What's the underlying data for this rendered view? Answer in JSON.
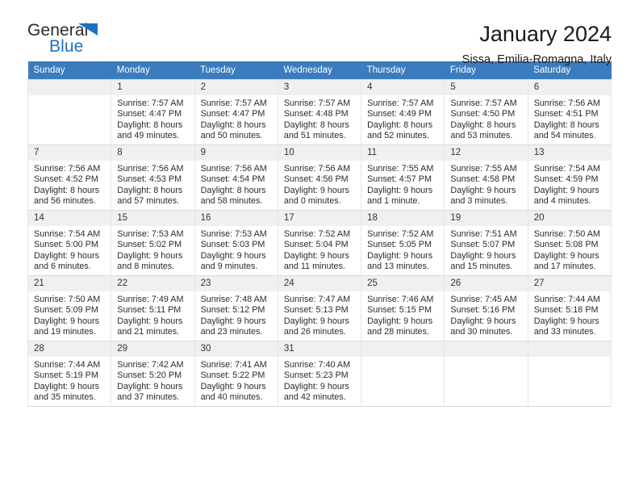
{
  "brand": {
    "name_part1": "General",
    "name_part2": "Blue",
    "triangle_icon": "triangle-icon",
    "accent_color": "#1a72c4"
  },
  "header": {
    "title": "January 2024",
    "subtitle": "Sissa, Emilia-Romagna, Italy"
  },
  "colors": {
    "header_row_bg": "#3a7cbe",
    "daynum_bg": "#f0f0f0",
    "grid_line": "#d9d9d9"
  },
  "calendar": {
    "weekday_headers": [
      "Sunday",
      "Monday",
      "Tuesday",
      "Wednesday",
      "Thursday",
      "Friday",
      "Saturday"
    ],
    "labels": {
      "sunrise": "Sunrise:",
      "sunset": "Sunset:",
      "daylight": "Daylight:"
    },
    "weeks": [
      [
        {
          "day": "",
          "empty": true
        },
        {
          "day": "1",
          "sunrise": "Sunrise: 7:57 AM",
          "sunset": "Sunset: 4:47 PM",
          "daylight": "Daylight: 8 hours and 49 minutes."
        },
        {
          "day": "2",
          "sunrise": "Sunrise: 7:57 AM",
          "sunset": "Sunset: 4:47 PM",
          "daylight": "Daylight: 8 hours and 50 minutes."
        },
        {
          "day": "3",
          "sunrise": "Sunrise: 7:57 AM",
          "sunset": "Sunset: 4:48 PM",
          "daylight": "Daylight: 8 hours and 51 minutes."
        },
        {
          "day": "4",
          "sunrise": "Sunrise: 7:57 AM",
          "sunset": "Sunset: 4:49 PM",
          "daylight": "Daylight: 8 hours and 52 minutes."
        },
        {
          "day": "5",
          "sunrise": "Sunrise: 7:57 AM",
          "sunset": "Sunset: 4:50 PM",
          "daylight": "Daylight: 8 hours and 53 minutes."
        },
        {
          "day": "6",
          "sunrise": "Sunrise: 7:56 AM",
          "sunset": "Sunset: 4:51 PM",
          "daylight": "Daylight: 8 hours and 54 minutes."
        }
      ],
      [
        {
          "day": "7",
          "sunrise": "Sunrise: 7:56 AM",
          "sunset": "Sunset: 4:52 PM",
          "daylight": "Daylight: 8 hours and 56 minutes."
        },
        {
          "day": "8",
          "sunrise": "Sunrise: 7:56 AM",
          "sunset": "Sunset: 4:53 PM",
          "daylight": "Daylight: 8 hours and 57 minutes."
        },
        {
          "day": "9",
          "sunrise": "Sunrise: 7:56 AM",
          "sunset": "Sunset: 4:54 PM",
          "daylight": "Daylight: 8 hours and 58 minutes."
        },
        {
          "day": "10",
          "sunrise": "Sunrise: 7:56 AM",
          "sunset": "Sunset: 4:56 PM",
          "daylight": "Daylight: 9 hours and 0 minutes."
        },
        {
          "day": "11",
          "sunrise": "Sunrise: 7:55 AM",
          "sunset": "Sunset: 4:57 PM",
          "daylight": "Daylight: 9 hours and 1 minute."
        },
        {
          "day": "12",
          "sunrise": "Sunrise: 7:55 AM",
          "sunset": "Sunset: 4:58 PM",
          "daylight": "Daylight: 9 hours and 3 minutes."
        },
        {
          "day": "13",
          "sunrise": "Sunrise: 7:54 AM",
          "sunset": "Sunset: 4:59 PM",
          "daylight": "Daylight: 9 hours and 4 minutes."
        }
      ],
      [
        {
          "day": "14",
          "sunrise": "Sunrise: 7:54 AM",
          "sunset": "Sunset: 5:00 PM",
          "daylight": "Daylight: 9 hours and 6 minutes."
        },
        {
          "day": "15",
          "sunrise": "Sunrise: 7:53 AM",
          "sunset": "Sunset: 5:02 PM",
          "daylight": "Daylight: 9 hours and 8 minutes."
        },
        {
          "day": "16",
          "sunrise": "Sunrise: 7:53 AM",
          "sunset": "Sunset: 5:03 PM",
          "daylight": "Daylight: 9 hours and 9 minutes."
        },
        {
          "day": "17",
          "sunrise": "Sunrise: 7:52 AM",
          "sunset": "Sunset: 5:04 PM",
          "daylight": "Daylight: 9 hours and 11 minutes."
        },
        {
          "day": "18",
          "sunrise": "Sunrise: 7:52 AM",
          "sunset": "Sunset: 5:05 PM",
          "daylight": "Daylight: 9 hours and 13 minutes."
        },
        {
          "day": "19",
          "sunrise": "Sunrise: 7:51 AM",
          "sunset": "Sunset: 5:07 PM",
          "daylight": "Daylight: 9 hours and 15 minutes."
        },
        {
          "day": "20",
          "sunrise": "Sunrise: 7:50 AM",
          "sunset": "Sunset: 5:08 PM",
          "daylight": "Daylight: 9 hours and 17 minutes."
        }
      ],
      [
        {
          "day": "21",
          "sunrise": "Sunrise: 7:50 AM",
          "sunset": "Sunset: 5:09 PM",
          "daylight": "Daylight: 9 hours and 19 minutes."
        },
        {
          "day": "22",
          "sunrise": "Sunrise: 7:49 AM",
          "sunset": "Sunset: 5:11 PM",
          "daylight": "Daylight: 9 hours and 21 minutes."
        },
        {
          "day": "23",
          "sunrise": "Sunrise: 7:48 AM",
          "sunset": "Sunset: 5:12 PM",
          "daylight": "Daylight: 9 hours and 23 minutes."
        },
        {
          "day": "24",
          "sunrise": "Sunrise: 7:47 AM",
          "sunset": "Sunset: 5:13 PM",
          "daylight": "Daylight: 9 hours and 26 minutes."
        },
        {
          "day": "25",
          "sunrise": "Sunrise: 7:46 AM",
          "sunset": "Sunset: 5:15 PM",
          "daylight": "Daylight: 9 hours and 28 minutes."
        },
        {
          "day": "26",
          "sunrise": "Sunrise: 7:45 AM",
          "sunset": "Sunset: 5:16 PM",
          "daylight": "Daylight: 9 hours and 30 minutes."
        },
        {
          "day": "27",
          "sunrise": "Sunrise: 7:44 AM",
          "sunset": "Sunset: 5:18 PM",
          "daylight": "Daylight: 9 hours and 33 minutes."
        }
      ],
      [
        {
          "day": "28",
          "sunrise": "Sunrise: 7:44 AM",
          "sunset": "Sunset: 5:19 PM",
          "daylight": "Daylight: 9 hours and 35 minutes."
        },
        {
          "day": "29",
          "sunrise": "Sunrise: 7:42 AM",
          "sunset": "Sunset: 5:20 PM",
          "daylight": "Daylight: 9 hours and 37 minutes."
        },
        {
          "day": "30",
          "sunrise": "Sunrise: 7:41 AM",
          "sunset": "Sunset: 5:22 PM",
          "daylight": "Daylight: 9 hours and 40 minutes."
        },
        {
          "day": "31",
          "sunrise": "Sunrise: 7:40 AM",
          "sunset": "Sunset: 5:23 PM",
          "daylight": "Daylight: 9 hours and 42 minutes."
        },
        {
          "day": "",
          "empty": true
        },
        {
          "day": "",
          "empty": true
        },
        {
          "day": "",
          "empty": true
        }
      ]
    ]
  }
}
